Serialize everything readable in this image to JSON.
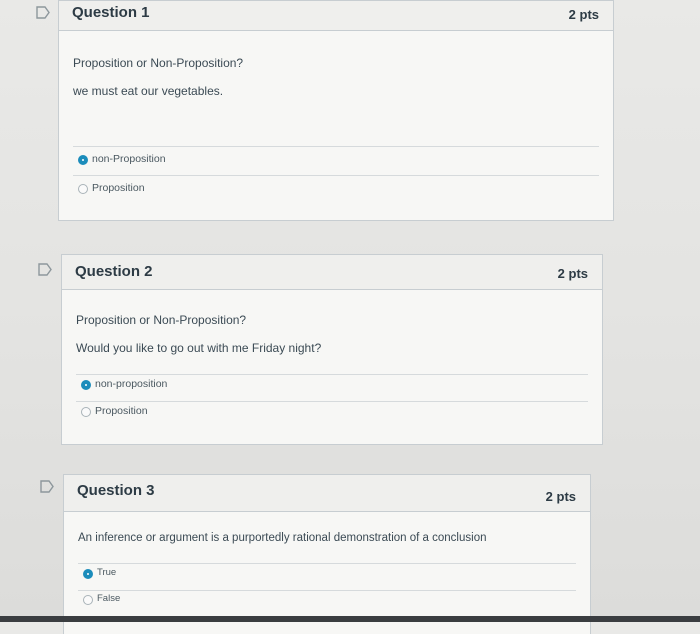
{
  "questions": [
    {
      "title": "Question 1",
      "points": "2 pts",
      "prompt": "Proposition or Non-Proposition?",
      "statement": "we must eat our vegetables.",
      "answers": [
        {
          "label": "non-Proposition",
          "selected": true
        },
        {
          "label": "Proposition",
          "selected": false
        }
      ]
    },
    {
      "title": "Question 2",
      "points": "2 pts",
      "prompt": "Proposition or Non-Proposition?",
      "statement": "Would you like to go out with me Friday night?",
      "answers": [
        {
          "label": "non-proposition",
          "selected": true
        },
        {
          "label": "Proposition",
          "selected": false
        }
      ]
    },
    {
      "title": "Question 3",
      "points": "2 pts",
      "prompt": "An inference or argument is a purportedly rational demonstration of a conclusion",
      "answers": [
        {
          "label": "True",
          "selected": true
        },
        {
          "label": "False",
          "selected": false
        }
      ]
    }
  ],
  "icons": {
    "flag": "flag-outline-icon",
    "radio_selected": "radio-selected-icon",
    "radio_empty": "radio-empty-icon"
  },
  "colors": {
    "accent": "#1b8cbb",
    "border": "#c7cdd1",
    "header": "#efefed"
  }
}
